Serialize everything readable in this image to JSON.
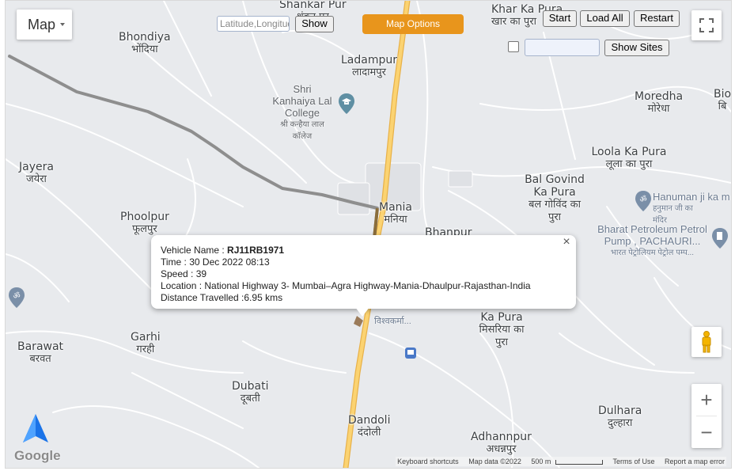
{
  "map": {
    "type_button_label": "Map",
    "search_placeholder": "Latitude,Longitude",
    "show_button": "Show",
    "map_options_button": "Map Options",
    "start_button": "Start",
    "load_all_button": "Load All",
    "restart_button": "Restart",
    "show_sites_button": "Show Sites",
    "zoom_in": "+",
    "zoom_out": "−",
    "google_logo": "Google",
    "attribution": {
      "shortcuts": "Keyboard shortcuts",
      "map_data": "Map data ©2022",
      "scale": "500 m",
      "terms": "Terms of Use",
      "report": "Report a map error"
    },
    "accent_color": "#e8951c",
    "route_color": "#888888"
  },
  "places": [
    {
      "id": "shankar-pur",
      "name": "Shankar Pur",
      "hi": "शंकर पुर"
    },
    {
      "id": "khar-ka-pura",
      "name": "Khar Ka Pura",
      "hi": "खार का पुरा"
    },
    {
      "id": "bhondiya",
      "name": "Bhondiya",
      "hi": "भोंदिया"
    },
    {
      "id": "ladampur",
      "name": "Ladampur",
      "hi": "लादामपुर"
    },
    {
      "id": "moredha",
      "name": "Moredha",
      "hi": "मोरेधा"
    },
    {
      "id": "bio",
      "name": "Bio",
      "hi": "बि"
    },
    {
      "id": "loola-ka-pura",
      "name": "Loola Ka Pura",
      "hi": "लूला का पुरा"
    },
    {
      "id": "jayera",
      "name": "Jayera",
      "hi": "जयेरा"
    },
    {
      "id": "bal-govind",
      "name": "Bal Govind Ka Pura",
      "hi": "बल गोविंद का पुरा"
    },
    {
      "id": "mania",
      "name": "Mania",
      "hi": "मनिया"
    },
    {
      "id": "phoolpur",
      "name": "Phoolpur",
      "hi": "फूलपुर"
    },
    {
      "id": "bhanpur",
      "name": "Bhanpur",
      "hi": ""
    },
    {
      "id": "misariya",
      "name": "Ka Pura",
      "hi": "मिसरिया का पुरा"
    },
    {
      "id": "garhi",
      "name": "Garhi",
      "hi": "गरही"
    },
    {
      "id": "barawat",
      "name": "Barawat",
      "hi": "बरवत"
    },
    {
      "id": "dubati",
      "name": "Dubati",
      "hi": "दूबती"
    },
    {
      "id": "dandoli",
      "name": "Dandoli",
      "hi": "दंदोली"
    },
    {
      "id": "dulhara",
      "name": "Dulhara",
      "hi": "दुल्हारा"
    },
    {
      "id": "adhannpur",
      "name": "Adhannpur",
      "hi": "अधन्नपुर"
    }
  ],
  "pois": {
    "college": {
      "name": "Shri Kanhaiya Lal College",
      "hi": "श्री कन्हैया लाल कॉलेज"
    },
    "temple": {
      "name": "Hanuman ji ka m",
      "hi": "हनुमान जी का मंदिर"
    },
    "petrol": {
      "name": "Bharat Petroleum Petrol Pump , PACHAURI...",
      "hi": "भारत पेट्रोलियम पेट्रोल पम्प..."
    },
    "petrol2": {
      "hi": "विश्वकर्मा..."
    }
  },
  "popup": {
    "vehicle_label": "Vehicle Name : ",
    "vehicle_value": "RJ11RB1971",
    "time": "Time : 30 Dec 2022 08:13",
    "speed": "Speed : 39",
    "location": "Location : National Highway 3- Mumbai–Agra Highway-Mania-Dhaulpur-Rajasthan-India",
    "distance": "Distance Travelled :6.95 kms",
    "close": "×"
  }
}
